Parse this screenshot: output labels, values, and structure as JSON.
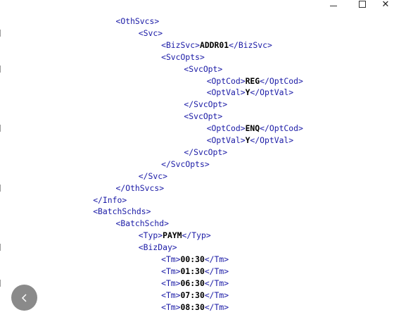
{
  "window": {
    "minimize_icon": "minimize-icon",
    "maximize_icon": "maximize-icon",
    "close_icon": "close-icon",
    "close_glyph": "✕"
  },
  "colors": {
    "tag": "#1a1aa6",
    "text": "#000000",
    "back_button": "#8a8a8a"
  },
  "xml_lines": [
    {
      "indent": 5,
      "open": "<OthSvcs>",
      "text": "",
      "close": ""
    },
    {
      "indent": 6,
      "open": "<Svc>",
      "text": "",
      "close": ""
    },
    {
      "indent": 7,
      "open": "<BizSvc>",
      "text": "ADDR01",
      "close": "</BizSvc>"
    },
    {
      "indent": 7,
      "open": "<SvcOpts>",
      "text": "",
      "close": ""
    },
    {
      "indent": 8,
      "open": "<SvcOpt>",
      "text": "",
      "close": ""
    },
    {
      "indent": 9,
      "open": "<OptCod>",
      "text": "REG",
      "close": "</OptCod>"
    },
    {
      "indent": 9,
      "open": "<OptVal>",
      "text": "Y",
      "close": "</OptVal>"
    },
    {
      "indent": 8,
      "open": "</SvcOpt>",
      "text": "",
      "close": ""
    },
    {
      "indent": 8,
      "open": "<SvcOpt>",
      "text": "",
      "close": ""
    },
    {
      "indent": 9,
      "open": "<OptCod>",
      "text": "ENQ",
      "close": "</OptCod>"
    },
    {
      "indent": 9,
      "open": "<OptVal>",
      "text": "Y",
      "close": "</OptVal>"
    },
    {
      "indent": 8,
      "open": "</SvcOpt>",
      "text": "",
      "close": ""
    },
    {
      "indent": 7,
      "open": "</SvcOpts>",
      "text": "",
      "close": ""
    },
    {
      "indent": 6,
      "open": "</Svc>",
      "text": "",
      "close": ""
    },
    {
      "indent": 5,
      "open": "</OthSvcs>",
      "text": "",
      "close": ""
    },
    {
      "indent": 4,
      "open": "</Info>",
      "text": "",
      "close": ""
    },
    {
      "indent": 4,
      "open": "<BatchSchds>",
      "text": "",
      "close": ""
    },
    {
      "indent": 5,
      "open": "<BatchSchd>",
      "text": "",
      "close": ""
    },
    {
      "indent": 6,
      "open": "<Typ>",
      "text": "PAYM",
      "close": "</Typ>"
    },
    {
      "indent": 6,
      "open": "<BizDay>",
      "text": "",
      "close": ""
    },
    {
      "indent": 7,
      "open": "<Tm>",
      "text": "00:30",
      "close": "</Tm>"
    },
    {
      "indent": 7,
      "open": "<Tm>",
      "text": "01:30",
      "close": "</Tm>"
    },
    {
      "indent": 7,
      "open": "<Tm>",
      "text": "06:30",
      "close": "</Tm>"
    },
    {
      "indent": 7,
      "open": "<Tm>",
      "text": "07:30",
      "close": "</Tm>"
    },
    {
      "indent": 7,
      "open": "<Tm>",
      "text": "08:30",
      "close": "</Tm>"
    }
  ],
  "back_button": {
    "icon": "chevron-left-icon"
  }
}
